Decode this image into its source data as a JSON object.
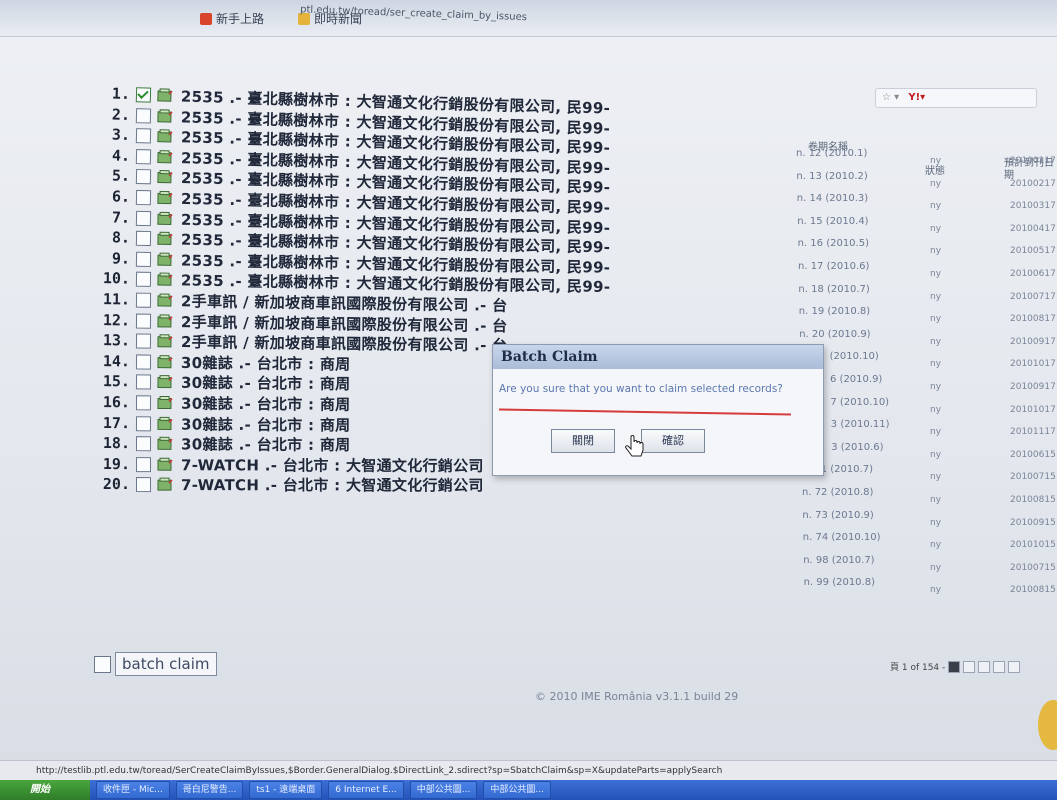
{
  "chrome": {
    "favorites": [
      "新手上路",
      "即時新聞"
    ],
    "url": "ptl.edu.tw/toread/ser_create_claim_by_issues"
  },
  "columns": {
    "issue": "卷期名稱",
    "status": "狀態",
    "expected": "預計到刊日期"
  },
  "rows": [
    {
      "n": "1.",
      "checked": true,
      "title": "2535 .- 臺北縣樹林市 : 大智通文化行銷股份有限公司, 民99-",
      "issue": "n. 12 (2010.1)",
      "status": "ny",
      "date": "20100117"
    },
    {
      "n": "2.",
      "checked": false,
      "title": "2535 .- 臺北縣樹林市 : 大智通文化行銷股份有限公司, 民99-",
      "issue": "n. 13 (2010.2)",
      "status": "ny",
      "date": "20100217"
    },
    {
      "n": "3.",
      "checked": false,
      "title": "2535 .- 臺北縣樹林市 : 大智通文化行銷股份有限公司, 民99-",
      "issue": "n. 14 (2010.3)",
      "status": "ny",
      "date": "20100317"
    },
    {
      "n": "4.",
      "checked": false,
      "title": "2535 .- 臺北縣樹林市 : 大智通文化行銷股份有限公司, 民99-",
      "issue": "n. 15 (2010.4)",
      "status": "ny",
      "date": "20100417"
    },
    {
      "n": "5.",
      "checked": false,
      "title": "2535 .- 臺北縣樹林市 : 大智通文化行銷股份有限公司, 民99-",
      "issue": "n. 16 (2010.5)",
      "status": "ny",
      "date": "20100517"
    },
    {
      "n": "6.",
      "checked": false,
      "title": "2535 .- 臺北縣樹林市 : 大智通文化行銷股份有限公司, 民99-",
      "issue": "n. 17 (2010.6)",
      "status": "ny",
      "date": "20100617"
    },
    {
      "n": "7.",
      "checked": false,
      "title": "2535 .- 臺北縣樹林市 : 大智通文化行銷股份有限公司, 民99-",
      "issue": "n. 18 (2010.7)",
      "status": "ny",
      "date": "20100717"
    },
    {
      "n": "8.",
      "checked": false,
      "title": "2535 .- 臺北縣樹林市 : 大智通文化行銷股份有限公司, 民99-",
      "issue": "n. 19 (2010.8)",
      "status": "ny",
      "date": "20100817"
    },
    {
      "n": "9.",
      "checked": false,
      "title": "2535 .- 臺北縣樹林市 : 大智通文化行銷股份有限公司, 民99-",
      "issue": "n. 20 (2010.9)",
      "status": "ny",
      "date": "20100917"
    },
    {
      "n": "10.",
      "checked": false,
      "title": "2535 .- 臺北縣樹林市 : 大智通文化行銷股份有限公司, 民99-",
      "issue": "(2010.10)",
      "status": "ny",
      "date": "20101017"
    },
    {
      "n": "11.",
      "checked": false,
      "title": "2手車訊 / 新加坡商車訊國際股份有限公司 .- 台",
      "issue": "6 (2010.9)",
      "status": "ny",
      "date": "20100917"
    },
    {
      "n": "12.",
      "checked": false,
      "title": "2手車訊 / 新加坡商車訊國際股份有限公司 .- 台",
      "issue": "7 (2010.10)",
      "status": "ny",
      "date": "20101017"
    },
    {
      "n": "13.",
      "checked": false,
      "title": "2手車訊 / 新加坡商車訊國際股份有限公司 .- 台",
      "issue": "3 (2010.11)",
      "status": "ny",
      "date": "20101117"
    },
    {
      "n": "14.",
      "checked": false,
      "title": "30雜誌 .- 台北市 : 商周",
      "issue": "3 (2010.6)",
      "status": "ny",
      "date": "20100615"
    },
    {
      "n": "15.",
      "checked": false,
      "title": "30雜誌 .- 台北市 : 商周",
      "issue": "n. 71 (2010.7)",
      "status": "ny",
      "date": "20100715"
    },
    {
      "n": "16.",
      "checked": false,
      "title": "30雜誌 .- 台北市 : 商周",
      "issue": "n. 72 (2010.8)",
      "status": "ny",
      "date": "20100815"
    },
    {
      "n": "17.",
      "checked": false,
      "title": "30雜誌 .- 台北市 : 商周",
      "issue": "n. 73 (2010.9)",
      "status": "ny",
      "date": "20100915"
    },
    {
      "n": "18.",
      "checked": false,
      "title": "30雜誌 .- 台北市 : 商周",
      "issue": "n. 74 (2010.10)",
      "status": "ny",
      "date": "20101015"
    },
    {
      "n": "19.",
      "checked": false,
      "title": "7-WATCH .- 台北市 : 大智通文化行銷公司",
      "issue": "n. 98 (2010.7)",
      "status": "ny",
      "date": "20100715"
    },
    {
      "n": "20.",
      "checked": false,
      "title": "7-WATCH .- 台北市 : 大智通文化行銷公司",
      "issue": "n. 99 (2010.8)",
      "status": "ny",
      "date": "20100815"
    }
  ],
  "dialog": {
    "title": "Batch Claim",
    "message": "Are you sure that you want to claim selected records?",
    "close_label": "關閉",
    "ok_label": "確認"
  },
  "batch": {
    "label": "batch claim"
  },
  "pager": {
    "text": "頁 1 of 154 -"
  },
  "footer": "© 2010 IME România v3.1.1 build 29",
  "status_url": "http://testlib.ptl.edu.tw/toread/SerCreateClaimByIssues,$Border.GeneralDialog.$DirectLink_2.sdirect?sp=SbatchClaim&sp=X&updateParts=applySearch",
  "taskbar": {
    "start": "開始",
    "tasks": [
      "收件匣 - Mic...",
      "哥白尼警告...",
      "ts1 - 遠端桌面",
      "6 Internet E...",
      "中部公共圖...",
      "中部公共圖..."
    ]
  },
  "colors": {
    "accent_red": "#d63b3b",
    "dialog_title_bg": "#b6c6df",
    "taskbar": "#2f62cc"
  }
}
